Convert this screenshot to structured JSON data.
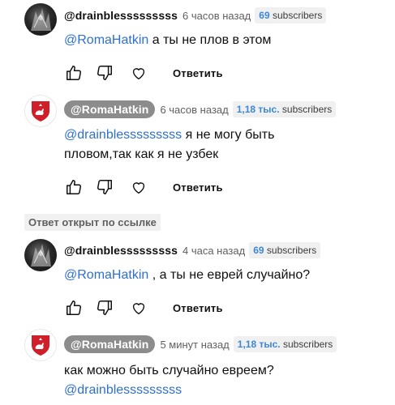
{
  "comments": [
    {
      "author": "@drainblesssssssss",
      "time": "6 часов назад",
      "subs_num": "69",
      "subs_word": "subscribers",
      "mention": "@RomaHatkin",
      "text": " а ты не плов в этом",
      "reply_label": "Ответить"
    },
    {
      "author": "@RomaHatkin",
      "time": "6 часов назад",
      "subs_num": "1,18 тыс.",
      "subs_word": "subscribers",
      "mention": "@drainblesssssssss",
      "text": " я не могу быть пловом,так как я не узбек",
      "reply_label": "Ответить"
    },
    {
      "author": "@drainblesssssssss",
      "time": "4 часа назад",
      "subs_num": "69",
      "subs_word": "subscribers",
      "mention": "@RomaHatkin",
      "text": " , а ты не еврей случайно?",
      "reply_label": "Ответить"
    },
    {
      "author": "@RomaHatkin",
      "time": "5 минут назад",
      "subs_num": "1,18 тыс.",
      "subs_word": "subscribers",
      "text": "как можно быть случайно евреем?",
      "mention": "@drainblesssssssss"
    }
  ],
  "linked_label": "Ответ открыт по ссылке",
  "icons": {
    "like": "thumb-up-icon",
    "dislike": "thumb-down-icon",
    "heart": "heart-icon"
  },
  "colors": {
    "mention": "#2e6fd1",
    "badge_number": "#3b88d8",
    "author_chip": "#8c8c8c"
  }
}
